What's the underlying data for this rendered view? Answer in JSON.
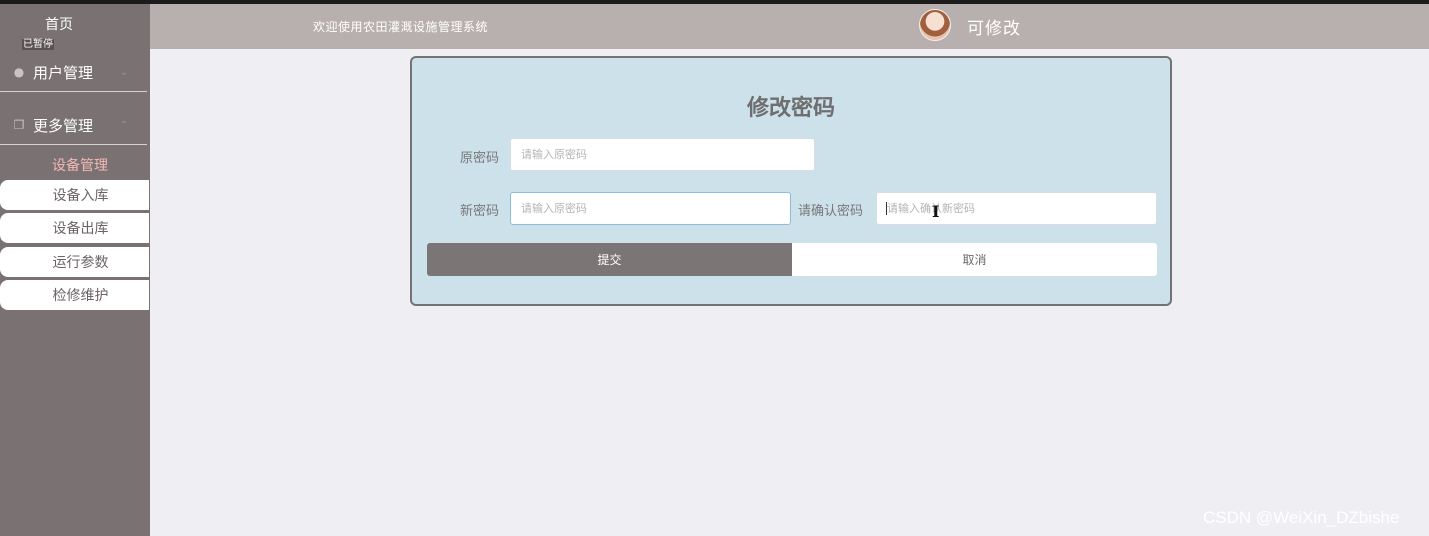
{
  "sidebar": {
    "home": "首页",
    "paused_badge": "已暂停",
    "menus": [
      {
        "label": "用户管理",
        "icon": "user-icon",
        "expanded": false
      },
      {
        "label": "更多管理",
        "icon": "window-icon",
        "expanded": true
      }
    ],
    "submenu_title": "设备管理",
    "submenu_items": [
      "设备入库",
      "设备出库",
      "运行参数",
      "检修维护"
    ]
  },
  "header": {
    "welcome": "欢迎使用农田灌溉设施管理系统",
    "username": "可修改"
  },
  "form": {
    "title": "修改密码",
    "old_password": {
      "label": "原密码",
      "placeholder": "请输入原密码",
      "value": ""
    },
    "new_password": {
      "label": "新密码",
      "placeholder": "请输入原密码",
      "value": ""
    },
    "confirm_password": {
      "label": "请确认密码",
      "placeholder": "请输入确认新密码",
      "value": ""
    },
    "submit_label": "提交",
    "cancel_label": "取消"
  },
  "watermark": "CSDN @WeiXin_DZbishe",
  "colors": {
    "sidebar_bg": "#7a7272",
    "header_bg": "#b8b0ae",
    "card_bg": "#cde1eb",
    "submit_bg": "#7c7575",
    "submenu_title": "#f2b8b8"
  }
}
